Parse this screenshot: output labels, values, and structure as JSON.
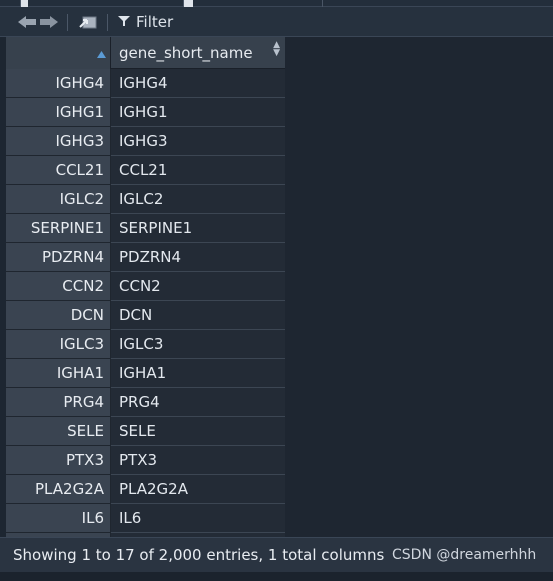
{
  "toolbar": {
    "filter_label": "Filter"
  },
  "grid": {
    "column_header": "gene_short_name",
    "rows": [
      {
        "name": "IGHG4",
        "value": "IGHG4"
      },
      {
        "name": "IGHG1",
        "value": "IGHG1"
      },
      {
        "name": "IGHG3",
        "value": "IGHG3"
      },
      {
        "name": "CCL21",
        "value": "CCL21"
      },
      {
        "name": "IGLC2",
        "value": "IGLC2"
      },
      {
        "name": "SERPINE1",
        "value": "SERPINE1"
      },
      {
        "name": "PDZRN4",
        "value": "PDZRN4"
      },
      {
        "name": "CCN2",
        "value": "CCN2"
      },
      {
        "name": "DCN",
        "value": "DCN"
      },
      {
        "name": "IGLC3",
        "value": "IGLC3"
      },
      {
        "name": "IGHA1",
        "value": "IGHA1"
      },
      {
        "name": "PRG4",
        "value": "PRG4"
      },
      {
        "name": "SELE",
        "value": "SELE"
      },
      {
        "name": "PTX3",
        "value": "PTX3"
      },
      {
        "name": "PLA2G2A",
        "value": "PLA2G2A"
      },
      {
        "name": "IL6",
        "value": "IL6"
      }
    ]
  },
  "footer": {
    "status": "Showing 1 to 17 of 2,000 entries, 1 total columns",
    "watermark": "CSDN @dreamerhhh"
  },
  "colors": {
    "background": "#1d2631",
    "header": "#37414d",
    "row_name_bg": "#3a4451",
    "cell_bg": "#232b36",
    "sort_accent": "#5b9bd5"
  }
}
